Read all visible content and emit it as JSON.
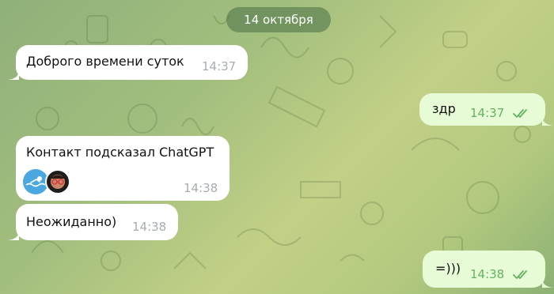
{
  "date_separator": "14 октября",
  "messages": [
    {
      "direction": "in",
      "text": "Доброго времени суток",
      "time": "14:37"
    },
    {
      "direction": "out",
      "text": "здр",
      "time": "14:37",
      "read": true
    },
    {
      "direction": "in",
      "text": "Контакт подсказал ChatGPT",
      "time": "14:38",
      "emoji": [
        "swimmer-icon",
        "glasses-face-icon"
      ]
    },
    {
      "direction": "in",
      "text": "Неожиданно)",
      "time": "14:38"
    },
    {
      "direction": "out",
      "text": "=)))",
      "time": "14:38",
      "read": true
    }
  ],
  "colors": {
    "incoming_bubble": "#ffffff",
    "outgoing_bubble": "#e8fbd7",
    "outgoing_time": "#63b35e",
    "incoming_time": "#a6adb0",
    "date_pill": "#487046"
  }
}
